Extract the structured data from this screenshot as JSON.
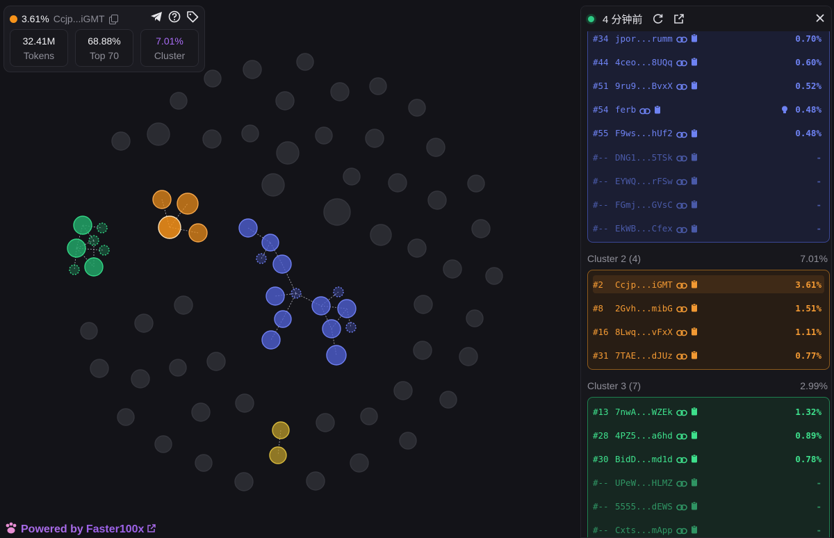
{
  "stats": {
    "percent": "3.61%",
    "address": "Ccjp...iGMT",
    "tokens_value": "32.41M",
    "tokens_label": "Tokens",
    "top_value": "68.88%",
    "top_label": "Top 70",
    "cluster_value": "7.01%",
    "cluster_label": "Cluster"
  },
  "powered": {
    "prefix": "Powered by",
    "brand": "Faster100x"
  },
  "panel": {
    "time_ago": "4 分钟前",
    "cluster1_rows": [
      {
        "rank": "#34",
        "addr": "jpor...rumm",
        "pct": "0.70%",
        "dim": false
      },
      {
        "rank": "#44",
        "addr": "4ceo...8UQq",
        "pct": "0.60%",
        "dim": false
      },
      {
        "rank": "#51",
        "addr": "9ru9...BvxX",
        "pct": "0.52%",
        "dim": false
      },
      {
        "rank": "#54",
        "addr": "ferb",
        "pct": "0.48%",
        "dim": false,
        "bulb": true
      },
      {
        "rank": "#55",
        "addr": "F9ws...hUf2",
        "pct": "0.48%",
        "dim": false
      },
      {
        "rank": "#--",
        "addr": "DNG1...5TSk",
        "pct": "-",
        "dim": true
      },
      {
        "rank": "#--",
        "addr": "EYWQ...rFSw",
        "pct": "-",
        "dim": true
      },
      {
        "rank": "#--",
        "addr": "FGmj...GVsC",
        "pct": "-",
        "dim": true
      },
      {
        "rank": "#--",
        "addr": "EkWB...Cfex",
        "pct": "-",
        "dim": true
      }
    ],
    "cluster2": {
      "title": "Cluster 2 (4)",
      "pct": "7.01%",
      "rows": [
        {
          "rank": "#2",
          "addr": "Ccjp...iGMT",
          "pct": "3.61%",
          "hl": true
        },
        {
          "rank": "#8",
          "addr": "2Gvh...mibG",
          "pct": "1.51%"
        },
        {
          "rank": "#16",
          "addr": "8Lwq...vFxX",
          "pct": "1.11%"
        },
        {
          "rank": "#31",
          "addr": "7TAE...dJUz",
          "pct": "0.77%"
        }
      ]
    },
    "cluster3": {
      "title": "Cluster 3 (7)",
      "pct": "2.99%",
      "rows": [
        {
          "rank": "#13",
          "addr": "7nwA...WZEk",
          "pct": "1.32%",
          "dim": false
        },
        {
          "rank": "#28",
          "addr": "4PZ5...a6hd",
          "pct": "0.89%",
          "dim": false
        },
        {
          "rank": "#30",
          "addr": "BidD...md1d",
          "pct": "0.78%",
          "dim": false
        },
        {
          "rank": "#--",
          "addr": "UPeW...HLMZ",
          "pct": "-",
          "dim": true
        },
        {
          "rank": "#--",
          "addr": "5555...dEWS",
          "pct": "-",
          "dim": true
        },
        {
          "rank": "#--",
          "addr": "Cxts...mApp",
          "pct": "-",
          "dim": true
        }
      ]
    }
  },
  "colors": {
    "orange": "#f7931a",
    "blue": "#4f5fd1",
    "green": "#22a467",
    "olive": "#b99a2a",
    "gray_node": "#2a2b31",
    "purple": "#a96cf5"
  }
}
